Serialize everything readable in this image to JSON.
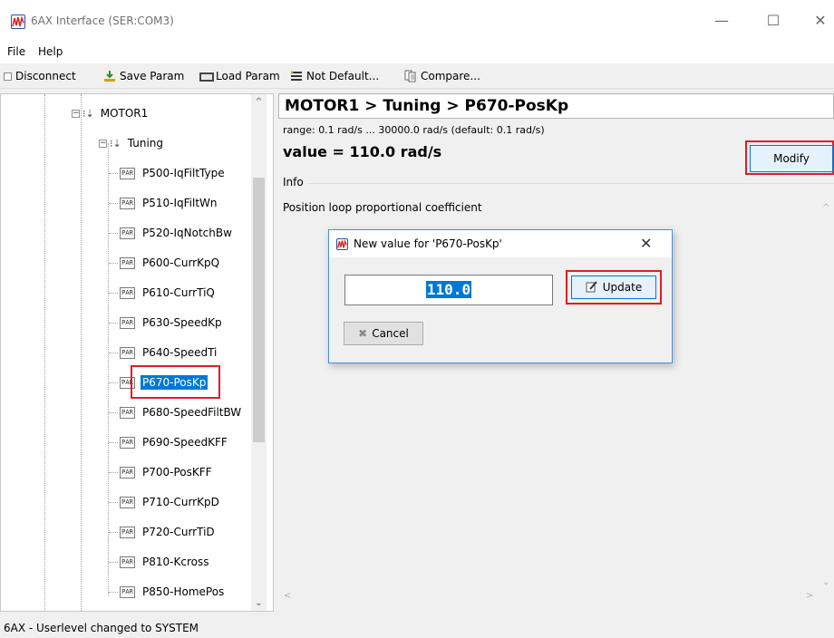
{
  "window": {
    "title": "6AX Interface (SER:COM3)",
    "minimize_glyph": "—",
    "maximize_glyph": "☐",
    "close_glyph": "✕"
  },
  "menu": {
    "file": "File",
    "help": "Help"
  },
  "toolbar": {
    "disconnect": "Disconnect",
    "save_param": "Save Param",
    "load_param": "Load Param",
    "not_default": "Not Default...",
    "compare": "Compare..."
  },
  "tree": {
    "motor": "MOTOR1",
    "group": "Tuning",
    "param_icon_text": "PAR",
    "selected": "P670-PosKp",
    "items": [
      "P500-IqFiltType",
      "P510-IqFiltWn",
      "P520-IqNotchBw",
      "P600-CurrKpQ",
      "P610-CurrTiQ",
      "P630-SpeedKp",
      "P640-SpeedTi",
      "P670-PosKp",
      "P680-SpeedFiltBW",
      "P690-SpeedKFF",
      "P700-PosKFF",
      "P710-CurrKpD",
      "P720-CurrTiD",
      "P810-Kcross",
      "P850-HomePos"
    ]
  },
  "detail": {
    "breadcrumb": "MOTOR1 > Tuning > P670-PosKp",
    "range": "range: 0.1 rad/s ... 30000.0 rad/s (default: 0.1 rad/s)",
    "value": "value = 110.0 rad/s",
    "modify_label": "Modify",
    "info_label": "Info",
    "info_text": "Position loop proportional coefficient"
  },
  "dialog": {
    "title": "New value for 'P670-PosKp'",
    "close_glyph": "✕",
    "input_value": "110.0",
    "update_label": "Update",
    "cancel_label": "Cancel"
  },
  "status": {
    "text": "6AX - Userlevel changed to SYSTEM"
  },
  "colors": {
    "selection": "#0078d7",
    "highlight_box": "#e41b23",
    "button_focus_bg": "#e5f1fb"
  },
  "icons": {
    "app": "waveform-logo-icon",
    "disconnect": "disconnect-icon",
    "save": "save-icon",
    "load": "load-folder-icon",
    "not_default": "filter-list-icon",
    "compare": "compare-icon",
    "motor": "motor-node-icon",
    "group": "group-node-icon",
    "param": "param-icon",
    "update": "edit-icon",
    "cancel": "cancel-x-icon"
  }
}
